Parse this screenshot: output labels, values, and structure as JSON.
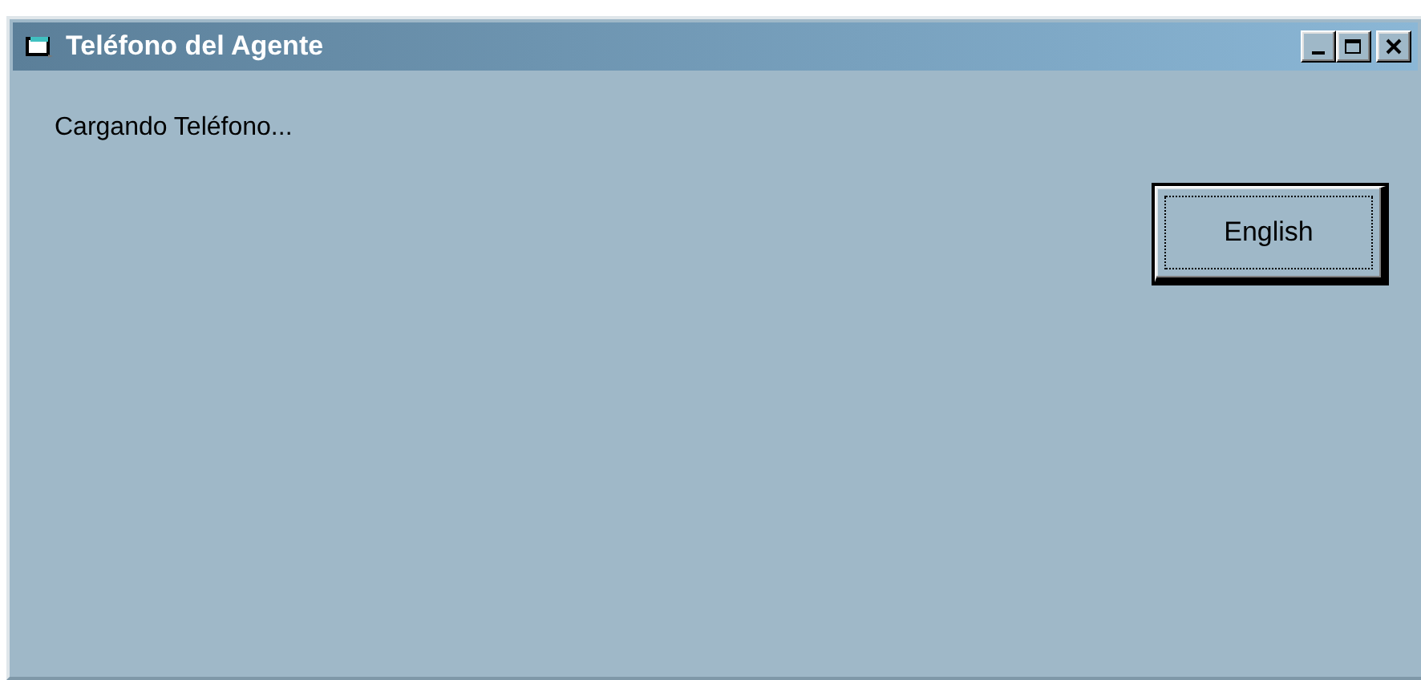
{
  "window": {
    "title": "Teléfono del Agente"
  },
  "status_text": "Cargando Teléfono...",
  "buttons": [
    {
      "label": "English",
      "focused": true
    }
  ]
}
